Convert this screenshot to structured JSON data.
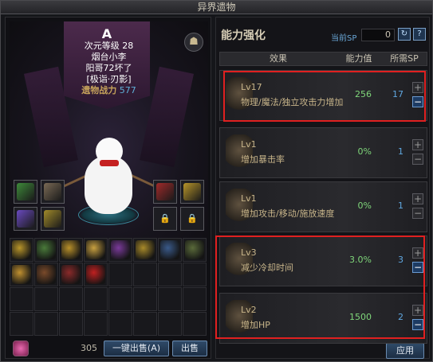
{
  "window": {
    "title": "异界遗物"
  },
  "character": {
    "rank_glyph": "A",
    "level_text": "次元等级 28",
    "name": "烟台小李",
    "guild": "阳哥72坏了",
    "tag": "[极诣·刃影]",
    "power_label": "遗物战力",
    "power_value": "577"
  },
  "equip_slots": {
    "left": [
      {
        "icon": "green-blade-icon",
        "color": "#3e8a3a"
      },
      {
        "icon": "claw-icon",
        "color": "#7a6a55"
      },
      {
        "icon": "purple-sword-icon",
        "color": "#6a4ac0"
      },
      {
        "icon": "yellow-claw-icon",
        "color": "#a08a2a"
      }
    ],
    "right": [
      {
        "icon": "red-dragon-icon",
        "color": "#a02a2a"
      },
      {
        "icon": "gold-cross-icon",
        "color": "#b8952a"
      },
      {
        "icon": "lock-icon",
        "label": "🔒"
      },
      {
        "icon": "lock-icon",
        "label": "🔒"
      }
    ]
  },
  "inventory": [
    {
      "icon": "gold-cross-icon",
      "color": "#b8952a"
    },
    {
      "icon": "claw-icon",
      "color": "#4a7a3a"
    },
    {
      "icon": "gold-claw-icon",
      "color": "#b8902a"
    },
    {
      "icon": "ring-icon",
      "color": "#c8a040"
    },
    {
      "icon": "purple-claw-icon",
      "color": "#7a3a9a"
    },
    {
      "icon": "gold-cross-icon",
      "color": "#a88a2a"
    },
    {
      "icon": "blue-gauntlet-icon",
      "color": "#3a5a8a"
    },
    {
      "icon": "claw-icon",
      "color": "#5a6a3a"
    },
    {
      "icon": "gold-claw-icon",
      "color": "#c09030"
    },
    {
      "icon": "brown-claw-icon",
      "color": "#7a4a2a"
    },
    {
      "icon": "red-gauntlet-icon",
      "color": "#8a2a2a"
    },
    {
      "icon": "red-orb-icon",
      "color": "#c02020"
    }
  ],
  "bottom": {
    "gem_count": "305",
    "sell_all_label": "一键出售(A)",
    "sell_label": "出售"
  },
  "panel": {
    "title": "能力强化",
    "sp_label": "当前SP",
    "sp_value": "0",
    "headers": {
      "effect": "效果",
      "value": "能力值",
      "required": "所需SP"
    },
    "apply_label": "应用",
    "rows": [
      {
        "level": "Lv17",
        "desc": "物理/魔法/独立攻击力增加",
        "value": "256",
        "required": "17",
        "minus_active": true,
        "highlight": true,
        "emblem": "axe-emblem-icon"
      },
      {
        "level": "Lv1",
        "desc": "增加暴击率",
        "value": "0%",
        "required": "1",
        "minus_active": false,
        "highlight": false,
        "emblem": "crosshair-emblem-icon"
      },
      {
        "level": "Lv1",
        "desc": "增加攻击/移动/施放速度",
        "value": "0%",
        "required": "1",
        "minus_active": false,
        "highlight": false,
        "emblem": "speed-emblem-icon"
      },
      {
        "level": "Lv3",
        "desc": "减少冷却时间",
        "value": "3.0%",
        "required": "3",
        "minus_active": true,
        "highlight": true,
        "emblem": "hourglass-emblem-icon"
      },
      {
        "level": "Lv2",
        "desc": "增加HP",
        "value": "1500",
        "required": "2",
        "minus_active": true,
        "highlight": true,
        "emblem": "heart-emblem-icon"
      }
    ]
  }
}
